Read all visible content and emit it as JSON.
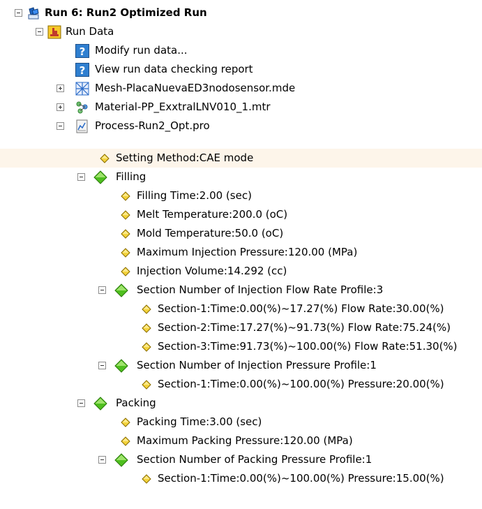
{
  "tree": {
    "root": "Run 6: Run2 Optimized Run",
    "run_data": "Run Data",
    "modify_run_data": "Modify run data...",
    "view_report": "View run data checking report",
    "mesh": "Mesh-PlacaNuevaED3nodosensor.mde",
    "material": "Material-PP_ExxtralLNV010_1.mtr",
    "process": "Process-Run2_Opt.pro",
    "setting_method": "Setting Method:CAE mode",
    "filling": {
      "label": "Filling",
      "filling_time": "Filling Time:2.00 (sec)",
      "melt_temp": "Melt Temperature:200.0 (oC)",
      "mold_temp": "Mold Temperature:50.0 (oC)",
      "max_inj_pressure": "Maximum Injection Pressure:120.00 (MPa)",
      "inj_volume": "Injection Volume:14.292 (cc)",
      "flow_profile": {
        "label": "Section Number of Injection Flow Rate Profile:3",
        "sections": [
          "Section-1:Time:0.00(%)~17.27(%) Flow Rate:30.00(%)",
          "Section-2:Time:17.27(%)~91.73(%) Flow Rate:75.24(%)",
          "Section-3:Time:91.73(%)~100.00(%) Flow Rate:51.30(%)"
        ]
      },
      "pressure_profile": {
        "label": "Section Number of Injection Pressure Profile:1",
        "sections": [
          "Section-1:Time:0.00(%)~100.00(%) Pressure:20.00(%)"
        ]
      }
    },
    "packing": {
      "label": "Packing",
      "packing_time": "Packing Time:3.00 (sec)",
      "max_pack_pressure": "Maximum Packing Pressure:120.00 (MPa)",
      "pressure_profile": {
        "label": "Section Number of Packing Pressure Profile:1",
        "sections": [
          "Section-1:Time:0.00(%)~100.00(%) Pressure:15.00(%)"
        ]
      }
    }
  }
}
